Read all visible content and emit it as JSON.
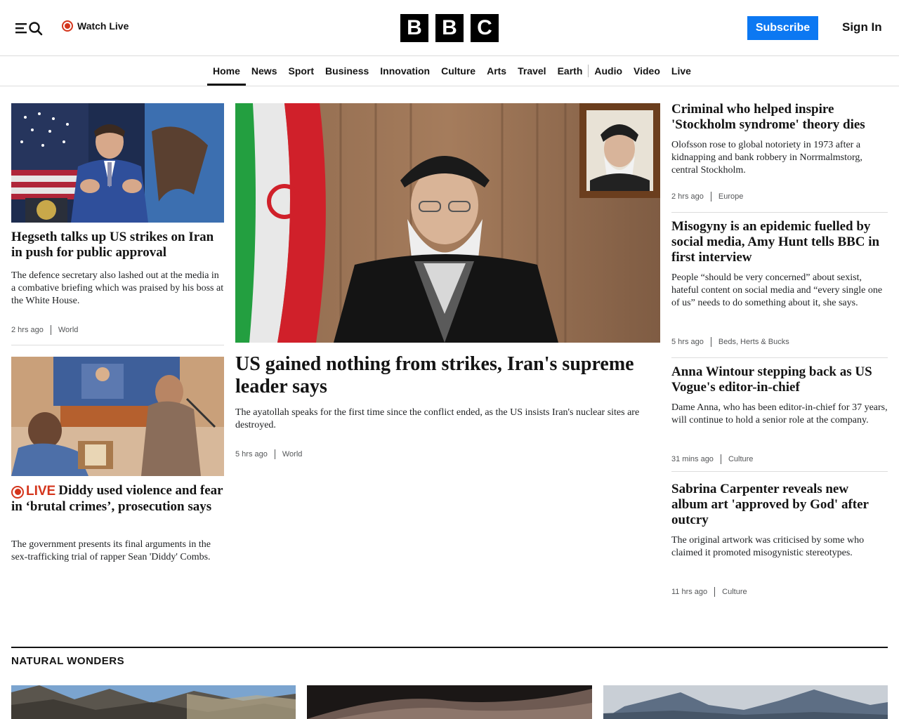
{
  "header": {
    "watch_live": "Watch Live",
    "logo_letters": [
      "B",
      "B",
      "C"
    ],
    "subscribe": "Subscribe",
    "sign_in": "Sign In"
  },
  "nav": {
    "items": [
      "Home",
      "News",
      "Sport",
      "Business",
      "Innovation",
      "Culture",
      "Arts",
      "Travel",
      "Earth",
      "Audio",
      "Video",
      "Live"
    ],
    "active": "Home"
  },
  "stories": {
    "left1": {
      "headline": "Hegseth talks up US strikes on Iran in push for public approval",
      "summary": "The defence secretary also lashed out at the media in a combative briefing which was praised by his boss at the White House.",
      "time": "2 hrs ago",
      "category": "World"
    },
    "left2": {
      "live_label": "LIVE",
      "headline": "Diddy used violence and fear in ‘brutal crimes’, prosecution says",
      "summary": "The government presents its final arguments in the sex-trafficking trial of rapper Sean 'Diddy' Combs."
    },
    "lead": {
      "headline": "US gained nothing from strikes, Iran's supreme leader says",
      "summary": "The ayatollah speaks for the first time since the conflict ended, as the US insists Iran's nuclear sites are destroyed.",
      "time": "5 hrs ago",
      "category": "World"
    },
    "right": [
      {
        "headline": "Criminal who helped inspire 'Stockholm syndrome' theory dies",
        "summary": "Olofsson rose to global notoriety in 1973 after a kidnapping and bank robbery in Norrmalmstorg, central Stockholm.",
        "time": "2 hrs ago",
        "category": "Europe"
      },
      {
        "headline": "Misogyny is an epidemic fuelled by social media, Amy Hunt tells BBC in first interview",
        "summary": "People “should be very concerned” about sexist, hateful content on social media and “every single one of us” needs to do something about it, she says.",
        "time": "5 hrs ago",
        "category": "Beds, Herts & Bucks"
      },
      {
        "headline": "Anna Wintour stepping back as US Vogue's editor-in-chief",
        "summary": "Dame Anna, who has been editor-in-chief for 37 years, will continue to hold a senior role at the company.",
        "time": "31 mins ago",
        "category": "Culture"
      },
      {
        "headline": "Sabrina Carpenter reveals new album art 'approved by God' after outcry",
        "summary": "The original artwork was criticised by some who claimed it promoted misogynistic stereotypes.",
        "time": "11 hrs ago",
        "category": "Culture"
      }
    ]
  },
  "section": {
    "title": "NATURAL WONDERS"
  },
  "colors": {
    "accent_blue": "#0c78f2",
    "live_red": "#d4351c",
    "text": "#141414"
  }
}
